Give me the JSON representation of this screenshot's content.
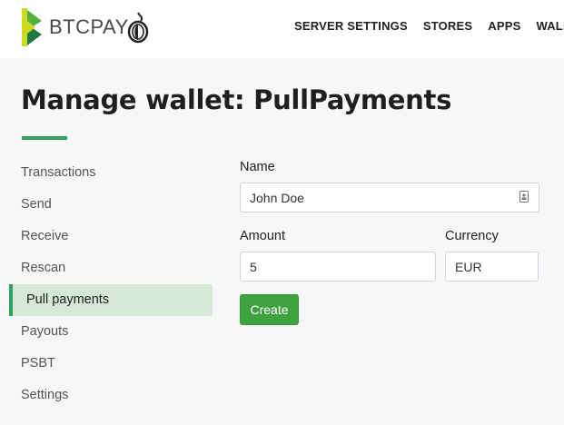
{
  "brand": {
    "name": "BTCPAY",
    "tor_icon": "onion-icon",
    "accent": "#329f5a"
  },
  "nav": [
    "SERVER SETTINGS",
    "STORES",
    "APPS",
    "WALLET"
  ],
  "page_title": "Manage wallet: PullPayments",
  "sidebar": [
    {
      "label": "Transactions",
      "active": false
    },
    {
      "label": "Send",
      "active": false
    },
    {
      "label": "Receive",
      "active": false
    },
    {
      "label": "Rescan",
      "active": false
    },
    {
      "label": "Pull payments",
      "active": true
    },
    {
      "label": "Payouts",
      "active": false
    },
    {
      "label": "PSBT",
      "active": false
    },
    {
      "label": "Settings",
      "active": false
    }
  ],
  "form": {
    "name_label": "Name",
    "name_value": "John Doe",
    "amount_label": "Amount",
    "amount_value": "5",
    "currency_label": "Currency",
    "currency_value": "EUR",
    "create_label": "Create"
  }
}
